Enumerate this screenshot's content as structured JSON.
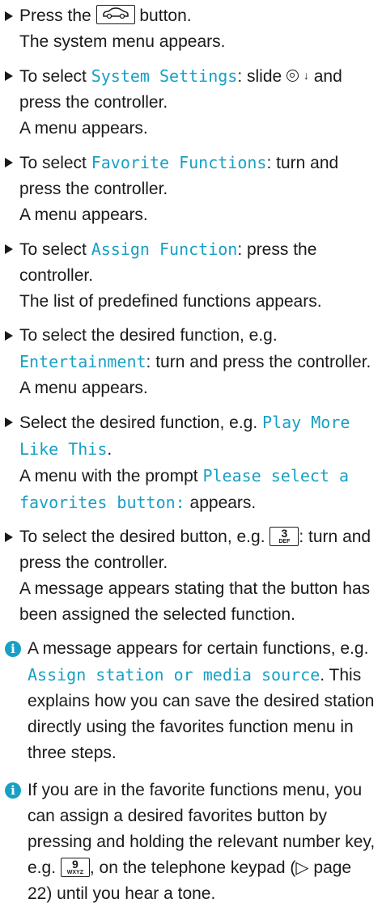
{
  "steps": [
    {
      "pre": "Press the ",
      "icon": "car-icon",
      "post": " button.",
      "result": "The system menu appears."
    },
    {
      "pre": "To select ",
      "mono": "System Settings",
      "mid": ": slide ",
      "post": " and press the controller.",
      "result": "A menu appears."
    },
    {
      "pre": "To select ",
      "mono": "Favorite Functions",
      "post": ": turn and press the controller.",
      "result": "A menu appears."
    },
    {
      "pre": "To select ",
      "mono": "Assign Function",
      "post": ": press the controller.",
      "result": "The list of predefined functions appears."
    },
    {
      "pre": "To select the desired function, e.g. ",
      "mono": "Entertainment",
      "post": ": turn and press the controller.",
      "result": "A menu appears."
    },
    {
      "pre": "Select the desired function, e.g. ",
      "mono": "Play More Like This",
      "post": ".",
      "result_pre": "A menu with the prompt ",
      "result_mono": "Please select a favorites button:",
      "result_post": " appears."
    },
    {
      "pre": "To select the desired button, e.g. ",
      "key_num": "3",
      "key_letters": "DEF",
      "post": ": turn and press the controller.",
      "result": "A message appears stating that the button has been assigned the selected function."
    }
  ],
  "notes": [
    {
      "pre": "A message appears for certain functions, e.g. ",
      "mono": "Assign station or media source",
      "post": ". This explains how you can save the desired station directly using the favorites function menu in three steps."
    },
    {
      "pre": "If you are in the favorite functions menu, you can assign a desired favorites button by pressing and holding the relevant number key, e.g. ",
      "key_num": "9",
      "key_letters": "WXYZ",
      "post": ", on the telephone keypad (",
      "ref_symbol": "▷",
      "ref": " page 22) until you hear a tone."
    }
  ],
  "info_icon_glyph": "i",
  "arrow_glyph": "↓"
}
